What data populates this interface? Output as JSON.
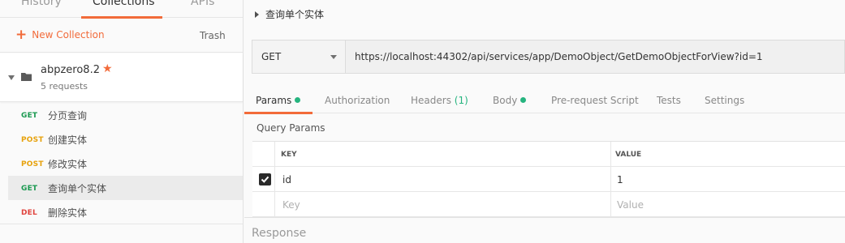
{
  "sidebar": {
    "tabs": [
      {
        "label": "History"
      },
      {
        "label": "Collections"
      },
      {
        "label": "APIs"
      }
    ],
    "new_collection_label": "New Collection",
    "trash_label": "Trash",
    "collection": {
      "name": "abpzero8.2",
      "count": "5 requests"
    },
    "requests": [
      {
        "method": "GET",
        "name": "分页查询"
      },
      {
        "method": "POST",
        "name": "创建实体"
      },
      {
        "method": "POST",
        "name": "修改实体"
      },
      {
        "method": "GET",
        "name": "查询单个实体"
      },
      {
        "method": "DEL",
        "name": "删除实体"
      }
    ]
  },
  "main": {
    "title": "查询单个实体",
    "method": "GET",
    "url": "https://localhost:44302/api/services/app/DemoObject/GetDemoObjectForView?id=1",
    "tabs": {
      "params": "Params",
      "authorization": "Authorization",
      "headers": "Headers",
      "headers_count": "(1)",
      "body": "Body",
      "prerequest": "Pre-request Script",
      "tests": "Tests",
      "settings": "Settings"
    },
    "query_params_label": "Query Params",
    "table": {
      "key_header": "KEY",
      "value_header": "VALUE",
      "rows": [
        {
          "key": "id",
          "value": "1",
          "checked": true
        }
      ],
      "key_placeholder": "Key",
      "value_placeholder": "Value"
    },
    "response_label": "Response"
  },
  "colors": {
    "accent": "#f26b3a",
    "get": "#1a9950",
    "post": "#e7a20d",
    "delete": "#e0433d",
    "indicator": "#26b47f"
  }
}
